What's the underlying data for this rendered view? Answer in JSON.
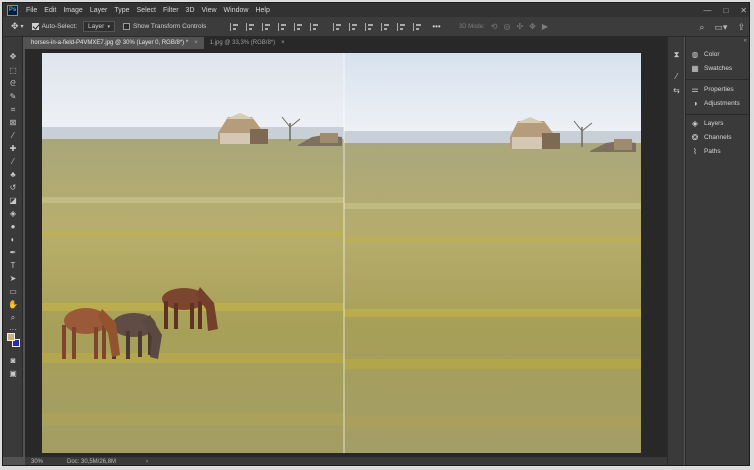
{
  "app": {
    "logo": "Ps",
    "menu": [
      "File",
      "Edit",
      "Image",
      "Layer",
      "Type",
      "Select",
      "Filter",
      "3D",
      "View",
      "Window",
      "Help"
    ],
    "window_controls": [
      "—",
      "□",
      "✕"
    ]
  },
  "options_bar": {
    "auto_select_label": "Auto-Select:",
    "auto_select_checked": true,
    "auto_select_target": "Layer",
    "show_transform_label": "Show Transform Controls",
    "show_transform_checked": false,
    "mode_3d_label": "3D Mode:"
  },
  "tabs": [
    {
      "label": "horses-in-a-field-P4VMXE7.jpg @ 30% (Layer 0, RGB/8*) *",
      "active": true
    },
    {
      "label": "1.jpg @ 33,3% (RGB/8*)",
      "active": false
    }
  ],
  "tab_close": "×",
  "status": {
    "zoom": "30%",
    "doc": "Doc: 30,5M/26,8M",
    "arrow": "›"
  },
  "panels": {
    "collapse": "«",
    "groups": [
      [
        {
          "icon": "palette-icon",
          "label": "Color"
        },
        {
          "icon": "grid-icon",
          "label": "Swatches"
        }
      ],
      [
        {
          "icon": "properties-icon",
          "label": "Properties"
        },
        {
          "icon": "adjustments-icon",
          "label": "Adjustments"
        }
      ],
      [
        {
          "icon": "layers-icon",
          "label": "Layers"
        },
        {
          "icon": "channels-icon",
          "label": "Channels"
        },
        {
          "icon": "paths-icon",
          "label": "Paths"
        }
      ]
    ]
  },
  "colors": {
    "foreground": "#c9b27a",
    "background": "#2a2ab0",
    "accent": "#31a8ff"
  }
}
